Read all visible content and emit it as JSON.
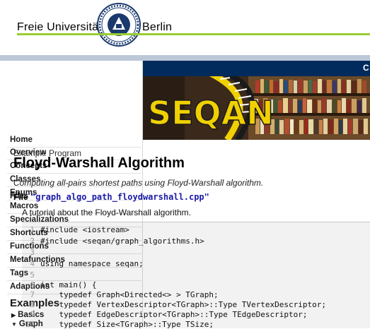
{
  "header": {
    "university_left": "Freie Universität",
    "university_right": "Berlin"
  },
  "banner": {
    "corner_text": "C",
    "logo_text": "SEQAN"
  },
  "sidebar": {
    "items": [
      {
        "label": "Home"
      },
      {
        "label": "Overview"
      },
      {
        "label": "Concepts"
      },
      {
        "label": "Classes"
      },
      {
        "label": "Enums"
      },
      {
        "label": "Files"
      },
      {
        "label": "Macros"
      },
      {
        "label": "Specializations"
      },
      {
        "label": "Shortcuts"
      },
      {
        "label": "Functions"
      },
      {
        "label": "Metafunctions"
      },
      {
        "label": "Tags"
      },
      {
        "label": "Adaptions"
      }
    ],
    "examples_heading": "Examples",
    "example_groups": [
      {
        "label": "Basics"
      },
      {
        "label": "Graph"
      }
    ]
  },
  "content": {
    "kicker": "Example Program",
    "title": "Floyd-Warshall Algorithm",
    "subtitle": "Computing all-pairs shortest paths using Floyd-Warshall algorithm.",
    "file_label": "File",
    "file_name": "\"graph_algo_path_floydwarshall.cpp\"",
    "description": "A tutorial about the Floyd-Warshall algorithm.",
    "code_lines": [
      {
        "n": "1",
        "text": "#include <iostream>"
      },
      {
        "n": "2",
        "text": "#include <seqan/graph_algorithms.h>"
      },
      {
        "n": "3",
        "text": ""
      },
      {
        "n": "4",
        "text": "using namespace seqan;"
      },
      {
        "n": "5",
        "text": ""
      },
      {
        "n": "6",
        "text": "int main() {"
      },
      {
        "n": "7",
        "text": "    typedef Graph<Directed<> > TGraph;"
      },
      {
        "n": "8",
        "text": "    typedef VertexDescriptor<TGraph>::Type TVertexDescriptor;"
      },
      {
        "n": "9",
        "text": "    typedef EdgeDescriptor<TGraph>::Type TEdgeDescriptor;"
      },
      {
        "n": "10",
        "text": "    typedef Size<TGraph>::Type TSize;"
      }
    ]
  }
}
